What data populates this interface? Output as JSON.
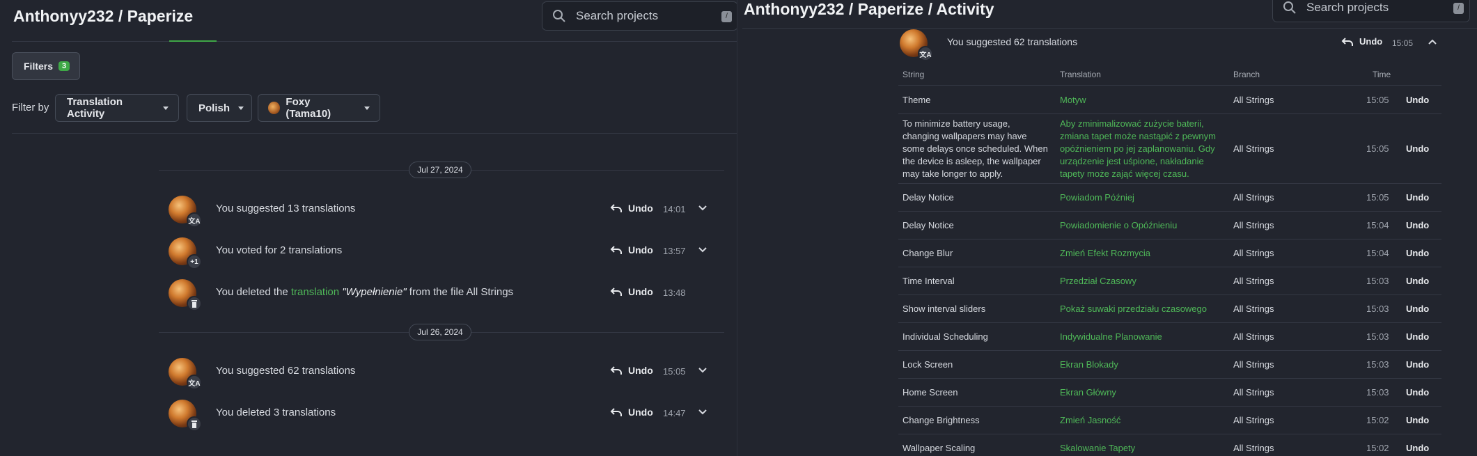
{
  "left": {
    "title": "Anthonyy232 / Paperize",
    "search": {
      "placeholder": "Search projects",
      "shortcut": "/"
    },
    "filters": {
      "label": "Filters",
      "count": "3"
    },
    "filter_by_label": "Filter by",
    "dropdowns": [
      "Translation Activity",
      "Polish",
      "Foxy (Tama10)"
    ],
    "groups": [
      {
        "date": "Jul 27, 2024",
        "items": [
          {
            "badge": "文A",
            "text": "You suggested 13 translations",
            "undo": "Undo",
            "time": "14:01",
            "expandable": true
          },
          {
            "badge": "+1",
            "text": "You voted for 2 translations",
            "undo": "Undo",
            "time": "13:57",
            "expandable": true
          },
          {
            "badge": "trash",
            "text_pre": "You deleted the ",
            "link": "translation",
            "quote": " \"Wypełnienie\"",
            "text_post": " from the file All Strings",
            "undo": "Undo",
            "time": "13:48",
            "expandable": false
          }
        ]
      },
      {
        "date": "Jul 26, 2024",
        "items": [
          {
            "badge": "文A",
            "text": "You suggested 62 translations",
            "undo": "Undo",
            "time": "15:05",
            "expandable": true
          },
          {
            "badge": "trash",
            "text": "You deleted 3 translations",
            "undo": "Undo",
            "time": "14:47",
            "expandable": true
          }
        ]
      }
    ]
  },
  "right": {
    "title": "Anthonyy232 / Paperize / Activity",
    "search": {
      "placeholder": "Search projects",
      "shortcut": "/"
    },
    "header_item": {
      "badge": "文A",
      "text": "You suggested 62 translations",
      "undo": "Undo",
      "time": "15:05"
    },
    "columns": [
      "String",
      "Translation",
      "Branch",
      "Time"
    ],
    "rows": [
      {
        "string": "Theme",
        "translation": "Motyw",
        "branch": "All Strings",
        "time": "15:05",
        "undo": "Undo"
      },
      {
        "string": "To minimize battery usage, changing wallpapers may have some delays once scheduled. When the device is asleep, the wallpaper may take longer to apply.",
        "translation": "Aby zminimalizować zużycie baterii, zmiana tapet może nastąpić z pewnym opóźnieniem po jej zaplanowaniu. Gdy urządzenie jest uśpione, nakładanie tapety może zająć więcej czasu.",
        "branch": "All Strings",
        "time": "15:05",
        "undo": "Undo"
      },
      {
        "string": "Delay Notice",
        "translation": "Powiadom Później",
        "branch": "All Strings",
        "time": "15:05",
        "undo": "Undo"
      },
      {
        "string": "Delay Notice",
        "translation": "Powiadomienie o Opóźnieniu",
        "branch": "All Strings",
        "time": "15:04",
        "undo": "Undo"
      },
      {
        "string": "Change Blur",
        "translation": "Zmień Efekt Rozmycia",
        "branch": "All Strings",
        "time": "15:04",
        "undo": "Undo"
      },
      {
        "string": "Time Interval",
        "translation": "Przedział Czasowy",
        "branch": "All Strings",
        "time": "15:03",
        "undo": "Undo"
      },
      {
        "string": "Show interval sliders",
        "translation": "Pokaż suwaki przedziału czasowego",
        "branch": "All Strings",
        "time": "15:03",
        "undo": "Undo"
      },
      {
        "string": "Individual Scheduling",
        "translation": "Indywidualne Planowanie",
        "branch": "All Strings",
        "time": "15:03",
        "undo": "Undo"
      },
      {
        "string": "Lock Screen",
        "translation": "Ekran Blokady",
        "branch": "All Strings",
        "time": "15:03",
        "undo": "Undo"
      },
      {
        "string": "Home Screen",
        "translation": "Ekran Główny",
        "branch": "All Strings",
        "time": "15:03",
        "undo": "Undo"
      },
      {
        "string": "Change Brightness",
        "translation": "Zmień Jasność",
        "branch": "All Strings",
        "time": "15:02",
        "undo": "Undo"
      },
      {
        "string": "Wallpaper Scaling",
        "translation": "Skalowanie Tapety",
        "branch": "All Strings",
        "time": "15:02",
        "undo": "Undo"
      }
    ]
  },
  "colors": {
    "background": "#22252e",
    "accent": "#3fa847",
    "link": "#4fb858"
  }
}
